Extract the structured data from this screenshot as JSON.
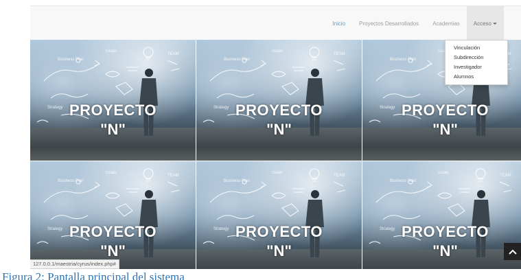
{
  "nav": {
    "items": [
      {
        "label": "Inicio",
        "state": "active"
      },
      {
        "label": "Proyectos Desarrollados",
        "state": "normal"
      },
      {
        "label": "Academias",
        "state": "normal"
      },
      {
        "label": "Acceso",
        "state": "open"
      }
    ]
  },
  "dropdown": {
    "items": [
      "Vinculación",
      "Subdirección",
      "Investigador",
      "Alumnos"
    ]
  },
  "tiles": [
    {
      "line1": "PROYECTO",
      "line2": "\"N\""
    },
    {
      "line1": "PROYECTO",
      "line2": "\"N\""
    },
    {
      "line1": "PROYECTO",
      "line2": "\"N\""
    },
    {
      "line1": "PROYECTO",
      "line2": "\"N\""
    },
    {
      "line1": "PROYECTO",
      "line2": "\"N\""
    },
    {
      "line1": "PROYECTO",
      "line2": "\"N\""
    }
  ],
  "status_url": "127.0.0.1/maestria/cyrus/index.php#",
  "caption": "Figura 2: Pantalla principal del sistema",
  "colors": {
    "accent": "#4aa3df",
    "caption": "#2e74b5"
  },
  "icons": {
    "scroll_top": "chevron-up-icon",
    "dropdown": "caret-down-icon"
  }
}
